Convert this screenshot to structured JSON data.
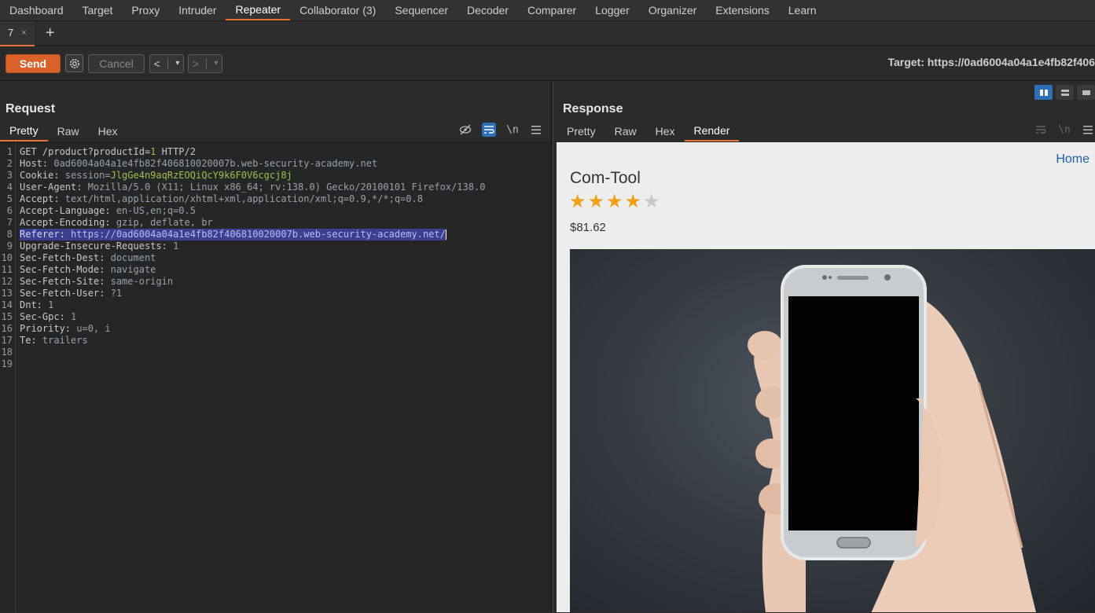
{
  "nav": {
    "tabs": [
      "Dashboard",
      "Target",
      "Proxy",
      "Intruder",
      "Repeater",
      "Collaborator (3)",
      "Sequencer",
      "Decoder",
      "Comparer",
      "Logger",
      "Organizer",
      "Extensions",
      "Learn"
    ],
    "active": "Repeater"
  },
  "subtabs": {
    "current_label": "7",
    "close_glyph": "×",
    "add_glyph": "+"
  },
  "toolbar": {
    "send_label": "Send",
    "cancel_label": "Cancel",
    "back_glyph": "<",
    "forward_glyph": ">",
    "dropdown_glyph": "▾",
    "target_text": "Target: https://0ad6004a04a1e4fb82f406"
  },
  "request": {
    "title": "Request",
    "tabs": [
      "Pretty",
      "Raw",
      "Hex"
    ],
    "active_tab": "Pretty",
    "newline_label": "\\n",
    "lines": [
      {
        "key": "GET /product?productId=",
        "val": "1",
        "tail": " HTTP/2",
        "type": "request-line"
      },
      {
        "key": "Host: ",
        "val": "0ad6004a04a1e4fb82f406810020007b.web-security-academy.net"
      },
      {
        "key": "Cookie: ",
        "val": "session=",
        "cookie": "JlgGe4n9aqRzEOQiQcY9k6F0V6cgcj8j",
        "type": "cookie"
      },
      {
        "key": "User-Agent: ",
        "val": "Mozilla/5.0 (X11; Linux x86_64; rv:138.0) Gecko/20100101 Firefox/138.0"
      },
      {
        "key": "Accept: ",
        "val": "text/html,application/xhtml+xml,application/xml;q=0.9,*/*;q=0.8"
      },
      {
        "key": "Accept-Language: ",
        "val": "en-US,en;q=0.5"
      },
      {
        "key": "Accept-Encoding: ",
        "val": "gzip, deflate, br"
      },
      {
        "key": "Referer: ",
        "val": "https://0ad6004a04a1e4fb82f406810020007b.web-security-academy.net/",
        "type": "highlight"
      },
      {
        "key": "Upgrade-Insecure-Requests: ",
        "val": "1"
      },
      {
        "key": "Sec-Fetch-Dest: ",
        "val": "document"
      },
      {
        "key": "Sec-Fetch-Mode: ",
        "val": "navigate"
      },
      {
        "key": "Sec-Fetch-Site: ",
        "val": "same-origin"
      },
      {
        "key": "Sec-Fetch-User: ",
        "val": "?1"
      },
      {
        "key": "Dnt: ",
        "val": "1"
      },
      {
        "key": "Sec-Gpc: ",
        "val": "1"
      },
      {
        "key": "Priority: ",
        "val": "u=0, i"
      },
      {
        "key": "Te: ",
        "val": "trailers"
      },
      {
        "key": "",
        "val": ""
      },
      {
        "key": "",
        "val": ""
      }
    ]
  },
  "response": {
    "title": "Response",
    "tabs": [
      "Pretty",
      "Raw",
      "Hex",
      "Render"
    ],
    "active_tab": "Render",
    "newline_label": "\\n",
    "render": {
      "home_link": "Home",
      "product_name": "Com-Tool",
      "rating": 4,
      "rating_max": 5,
      "price": "$81.62"
    }
  },
  "colors": {
    "accent": "#e8713a",
    "send": "#d9622b",
    "highlight": "#3b3f8c",
    "star_on": "#f0a018",
    "star_off": "#c8c8c8",
    "link": "#1f5ea8"
  }
}
